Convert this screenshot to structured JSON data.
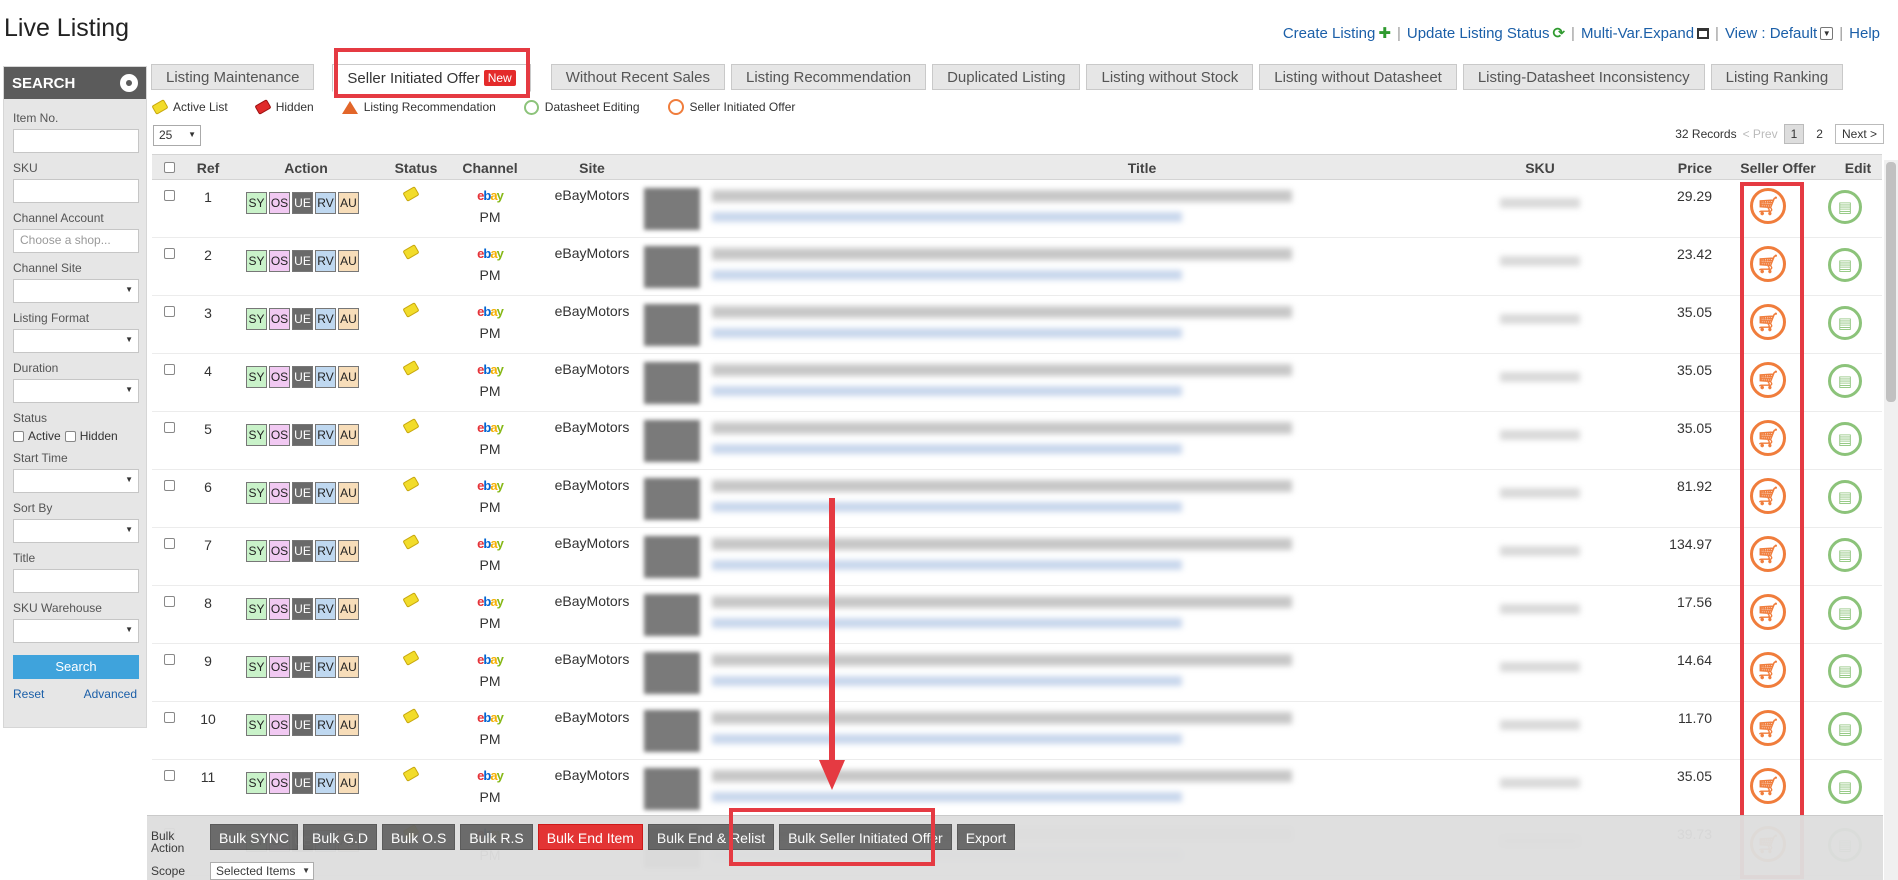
{
  "header": {
    "title": "Live Listing",
    "links": [
      {
        "label": "Create Listing",
        "icon": "plus-icon"
      },
      {
        "label": "Update Listing Status",
        "icon": "refresh-icon"
      },
      {
        "label": "Multi-Var.Expand",
        "icon": "grid-icon"
      },
      {
        "label": "View : Default",
        "icon": "dropdown-icon"
      },
      {
        "label": "Help"
      }
    ]
  },
  "sidebar": {
    "title": "SEARCH",
    "fields": {
      "item_no": "Item No.",
      "sku": "SKU",
      "channel_account": "Channel Account",
      "channel_account_placeholder": "Choose a shop...",
      "channel_site": "Channel Site",
      "listing_format": "Listing Format",
      "duration": "Duration",
      "status": "Status",
      "status_active": "Active",
      "status_hidden": "Hidden",
      "start_time": "Start Time",
      "sort_by": "Sort By",
      "title": "Title",
      "sku_warehouse": "SKU Warehouse"
    },
    "search_button": "Search",
    "reset_link": "Reset",
    "advanced_link": "Advanced"
  },
  "tabs": [
    {
      "label": "Listing Maintenance"
    },
    {
      "label": "Seller Initiated Offer",
      "badge": "New",
      "active": true
    },
    {
      "label": "Without Recent Sales"
    },
    {
      "label": "Listing Recommendation"
    },
    {
      "label": "Duplicated Listing"
    },
    {
      "label": "Listing without Stock"
    },
    {
      "label": "Listing without Datasheet"
    },
    {
      "label": "Listing-Datasheet Inconsistency"
    },
    {
      "label": "Listing Ranking"
    }
  ],
  "legend": {
    "active_list": "Active List",
    "hidden": "Hidden",
    "listing_recommendation": "Listing Recommendation",
    "datasheet_editing": "Datasheet Editing",
    "seller_initiated_offer": "Seller Initiated Offer"
  },
  "pager": {
    "per_page": "25",
    "records": "32 Records",
    "prev": "< Prev",
    "pages": [
      "1",
      "2"
    ],
    "next": "Next >"
  },
  "table": {
    "columns": {
      "ref": "Ref",
      "action": "Action",
      "status": "Status",
      "channel": "Channel",
      "site": "Site",
      "title": "Title",
      "sku": "SKU",
      "price": "Price",
      "seller_offer": "Seller Offer",
      "edit": "Edit"
    },
    "action_buttons": [
      "SY",
      "OS",
      "UE",
      "RV",
      "AU"
    ],
    "channel_logo": "ebay",
    "rows": [
      {
        "ref": "1",
        "channel_sub": "PM",
        "site": "eBayMotors",
        "price": "29.29"
      },
      {
        "ref": "2",
        "channel_sub": "PM",
        "site": "eBayMotors",
        "price": "23.42"
      },
      {
        "ref": "3",
        "channel_sub": "PM",
        "site": "eBayMotors",
        "price": "35.05"
      },
      {
        "ref": "4",
        "channel_sub": "PM",
        "site": "eBayMotors",
        "price": "35.05"
      },
      {
        "ref": "5",
        "channel_sub": "PM",
        "site": "eBayMotors",
        "price": "35.05"
      },
      {
        "ref": "6",
        "channel_sub": "PM",
        "site": "eBayMotors",
        "price": "81.92"
      },
      {
        "ref": "7",
        "channel_sub": "PM",
        "site": "eBayMotors",
        "price": "134.97"
      },
      {
        "ref": "8",
        "channel_sub": "PM",
        "site": "eBayMotors",
        "price": "17.56"
      },
      {
        "ref": "9",
        "channel_sub": "PM",
        "site": "eBayMotors",
        "price": "14.64"
      },
      {
        "ref": "10",
        "channel_sub": "PM",
        "site": "eBayMotors",
        "price": "11.70"
      },
      {
        "ref": "11",
        "channel_sub": "PM",
        "site": "eBayMotors",
        "price": "35.05"
      },
      {
        "ref": "",
        "channel_sub": "PM",
        "site": "",
        "price": "39.73"
      }
    ]
  },
  "bulk": {
    "label": "Bulk Action",
    "buttons": [
      {
        "label": "Bulk SYNC"
      },
      {
        "label": "Bulk G.D"
      },
      {
        "label": "Bulk O.S"
      },
      {
        "label": "Bulk R.S"
      },
      {
        "label": "Bulk End Item",
        "red": true
      },
      {
        "label": "Bulk End & Relist"
      },
      {
        "label": "Bulk Seller Initiated Offer"
      },
      {
        "label": "Export"
      }
    ],
    "scope_label": "Scope",
    "scope_value": "Selected Items"
  },
  "colors": {
    "highlight": "#e53a42",
    "link": "#1b5fa8",
    "offer_orange": "#f07d3c",
    "edit_green": "#8cc37a"
  }
}
